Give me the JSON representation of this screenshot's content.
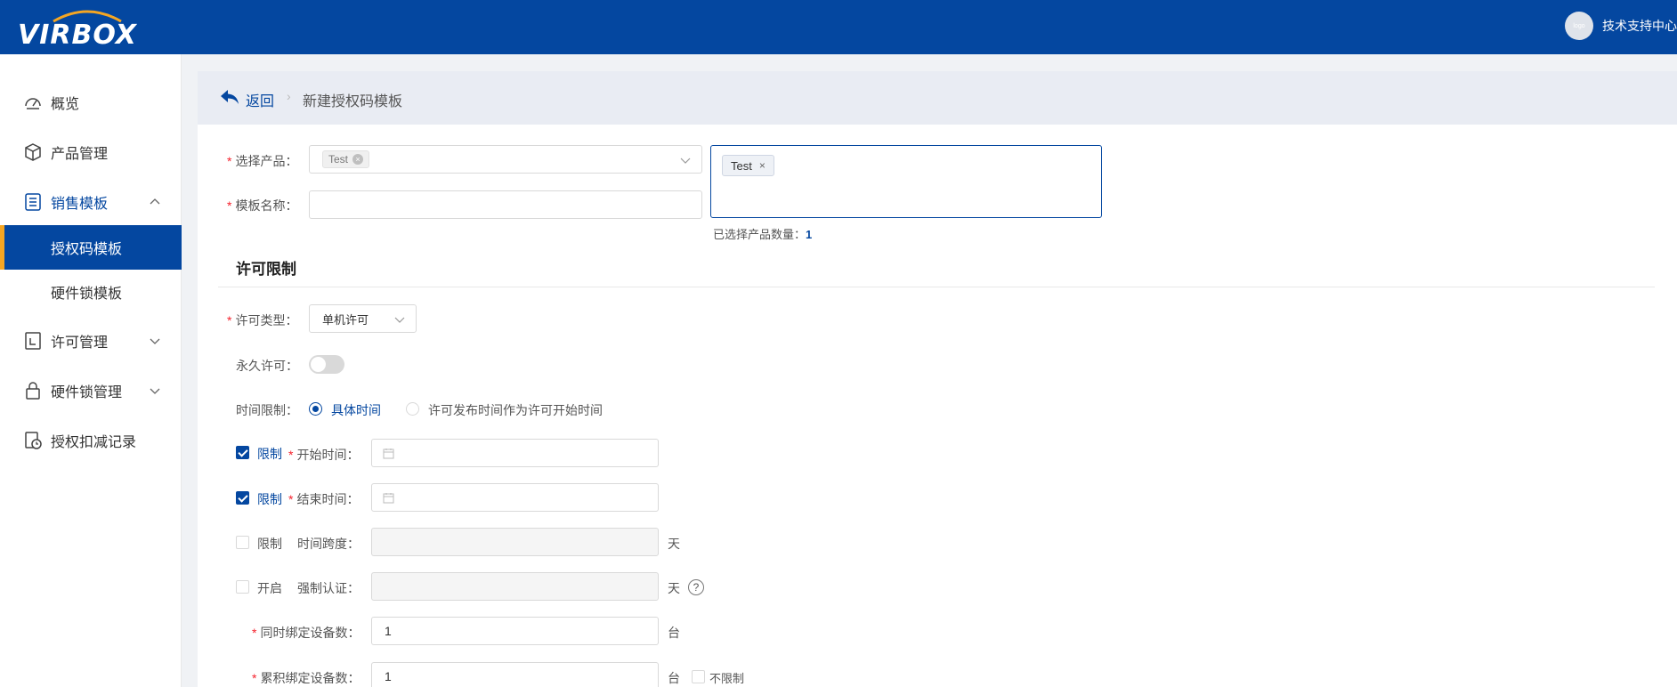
{
  "header": {
    "logo_text": "VIRBOX",
    "avatar_text": "logo",
    "user_name": "技术支持中心"
  },
  "sidebar": {
    "items": [
      {
        "label": "概览",
        "icon": "dashboard-icon"
      },
      {
        "label": "产品管理",
        "icon": "cube-icon"
      },
      {
        "label": "销售模板",
        "icon": "list-icon",
        "expanded": true
      },
      {
        "label": "授权码模板",
        "selected": true
      },
      {
        "label": "硬件锁模板"
      },
      {
        "label": "许可管理",
        "icon": "license-icon"
      },
      {
        "label": "硬件锁管理",
        "icon": "lock-icon"
      },
      {
        "label": "授权扣减记录",
        "icon": "history-icon"
      }
    ]
  },
  "breadcrumb": {
    "back_label": "返回",
    "current": "新建授权码模板"
  },
  "form": {
    "product_label": "选择产品：",
    "product_tag": "Test",
    "template_name_label": "模板名称：",
    "template_name_value": "",
    "selected_tag": "Test",
    "selected_count_label": "已选择产品数量：",
    "selected_count_value": "1",
    "section_title": "许可限制",
    "license_type_label": "许可类型：",
    "license_type_value": "单机许可",
    "permanent_label": "永久许可：",
    "permanent_on": false,
    "time_limit_label": "时间限制：",
    "time_option_specific": "具体时间",
    "time_option_publish": "许可发布时间作为许可开始时间",
    "start_limit_label": "限制",
    "start_time_label": "开始时间：",
    "end_limit_label": "限制",
    "end_time_label": "结束时间：",
    "span_limit_label": "限制",
    "span_label": "时间跨度：",
    "span_unit": "天",
    "force_label_check": "开启",
    "force_label": "强制认证：",
    "force_unit": "天",
    "help_glyph": "?",
    "bind_simul_label": "同时绑定设备数：",
    "bind_simul_value": "1",
    "bind_simul_unit": "台",
    "bind_total_label": "累积绑定设备数：",
    "bind_total_value": "1",
    "bind_total_unit": "台",
    "no_limit_label": "不限制"
  },
  "colors": {
    "primary": "#0447a0",
    "accent": "#f5a623",
    "required": "#f5222d"
  }
}
